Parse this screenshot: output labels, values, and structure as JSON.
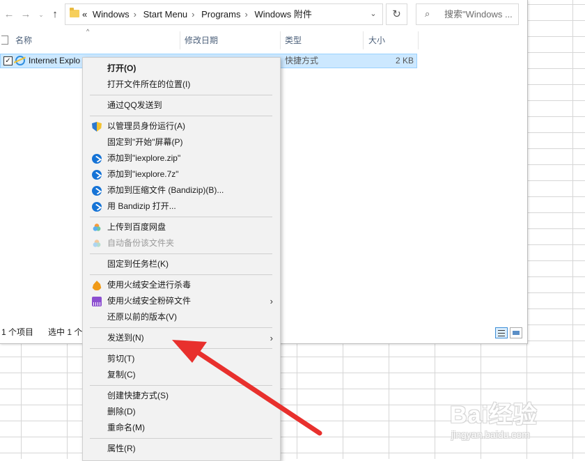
{
  "toolbar": {
    "back_icon": "arrow-left-icon",
    "forward_icon": "arrow-right-icon",
    "recent_icon": "chevron-down-icon",
    "up_icon": "arrow-up-icon"
  },
  "address": {
    "overflow": "«",
    "crumbs": [
      "Windows",
      "Start Menu",
      "Programs",
      "Windows 附件"
    ],
    "separator": "›"
  },
  "search": {
    "placeholder": "搜索\"Windows ..."
  },
  "columns": {
    "name": "名称",
    "modified": "修改日期",
    "type": "类型",
    "size": "大小"
  },
  "file_row": {
    "name": "Internet Explo",
    "type": "快捷方式",
    "size": "2 KB",
    "checked": true
  },
  "status": {
    "count": "1 个项目",
    "selected": "选中 1 个"
  },
  "context_menu": {
    "items": [
      {
        "label": "打开(O)",
        "bold": true
      },
      {
        "label": "打开文件所在的位置(I)"
      },
      {
        "label": "通过QQ发送到"
      },
      {
        "label": "以管理员身份运行(A)",
        "icon": "uac-shield-icon"
      },
      {
        "label": "固定到\"开始\"屏幕(P)"
      },
      {
        "label": "添加到\"iexplore.zip\"",
        "icon": "bandizip-icon"
      },
      {
        "label": "添加到\"iexplore.7z\"",
        "icon": "bandizip-icon"
      },
      {
        "label": "添加到压缩文件 (Bandizip)(B)...",
        "icon": "bandizip-icon"
      },
      {
        "label": "用 Bandizip 打开...",
        "icon": "bandizip-icon"
      },
      {
        "label": "上传到百度网盘",
        "icon": "baidu-netdisk-icon"
      },
      {
        "label": "自动备份该文件夹",
        "icon": "baidu-netdisk-icon",
        "disabled": true
      },
      {
        "label": "固定到任务栏(K)"
      },
      {
        "label": "使用火绒安全进行杀毒",
        "icon": "huorong-icon"
      },
      {
        "label": "使用火绒安全粉碎文件",
        "icon": "shredder-icon",
        "submenu": true
      },
      {
        "label": "还原以前的版本(V)"
      },
      {
        "label": "发送到(N)",
        "submenu": true
      },
      {
        "label": "剪切(T)"
      },
      {
        "label": "复制(C)"
      },
      {
        "label": "创建快捷方式(S)"
      },
      {
        "label": "删除(D)"
      },
      {
        "label": "重命名(M)"
      },
      {
        "label": "属性(R)"
      }
    ]
  },
  "annotation": {
    "color": "#e8302d"
  },
  "watermark": {
    "logo": "Bai经验",
    "url": "jingyan.baidu.com"
  },
  "colors": {
    "selection": "#cce8ff",
    "menu_bg": "#f2f2f2",
    "bandizip": "#1573d6"
  }
}
